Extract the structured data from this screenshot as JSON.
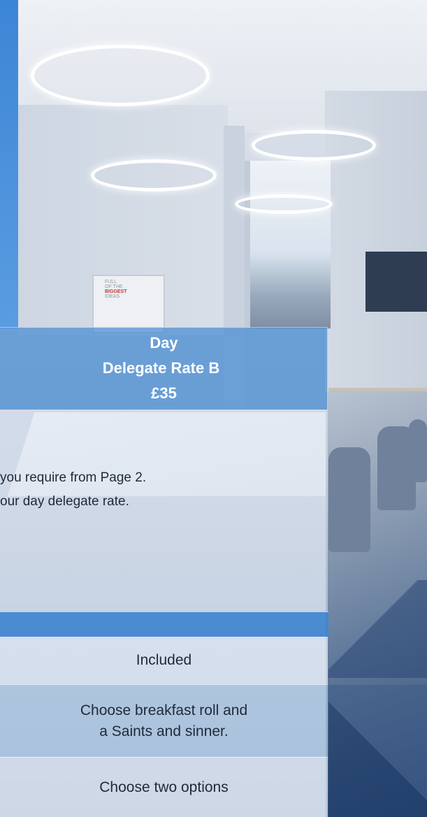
{
  "header": {
    "line1": "Day",
    "line2": "Delegate Rate B",
    "line3": "£35"
  },
  "body": {
    "line1": "you require from Page 2.",
    "line2": "our day delegate rate."
  },
  "flipchart": {
    "line1": "FULL",
    "line2": "OF THE",
    "line3": "BIGGEST",
    "line4": "IDEAS"
  },
  "rows": [
    {
      "text": "Included"
    },
    {
      "line1": "Choose breakfast roll and",
      "line2": "a Saints and sinner."
    },
    {
      "text": "Choose two options"
    }
  ],
  "colors": {
    "header_bg": "#468cd2",
    "bar_bg": "#4287d2",
    "text": "#1f2a38"
  }
}
